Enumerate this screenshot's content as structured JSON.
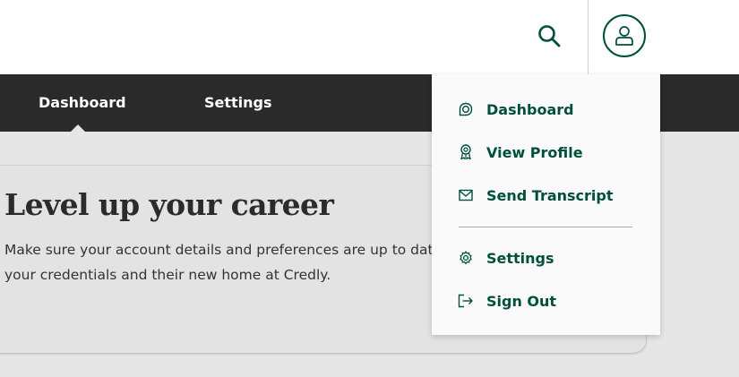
{
  "header": {
    "search_icon": "search-icon",
    "avatar_icon": "user-icon"
  },
  "nav": {
    "tabs": [
      {
        "label": "Dashboard",
        "active": true
      },
      {
        "label": "Settings",
        "active": false
      }
    ]
  },
  "card": {
    "title": "Level up your career",
    "text": "Make sure your account details and preferences are up to date s out of your credentials and their new home at Credly."
  },
  "user_menu": {
    "items": [
      {
        "label": "Dashboard",
        "icon": "dashboard-icon"
      },
      {
        "label": "View Profile",
        "icon": "badge-icon"
      },
      {
        "label": "Send Transcript",
        "icon": "envelope-icon"
      },
      {
        "label": "Settings",
        "icon": "gear-icon"
      },
      {
        "label": "Sign Out",
        "icon": "sign-out-icon"
      }
    ]
  },
  "colors": {
    "brand_green": "#004f3d",
    "nav_background": "#2a2a2a",
    "page_background": "#e6e6e6"
  }
}
